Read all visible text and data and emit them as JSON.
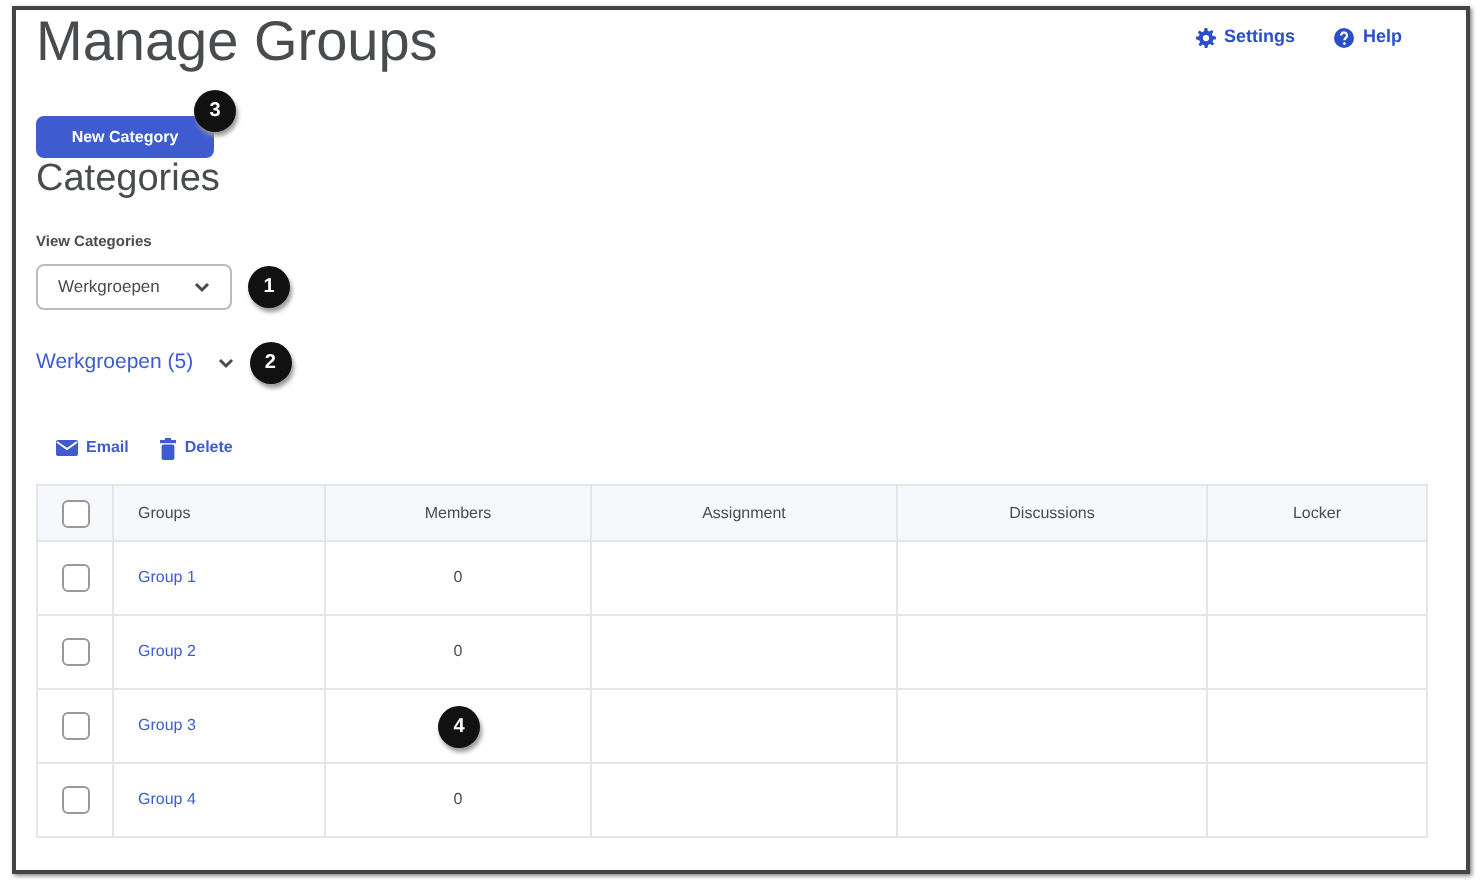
{
  "header": {
    "title": "Manage Groups",
    "links": [
      {
        "label": "Settings",
        "kind": "settings"
      },
      {
        "label": "Help",
        "kind": "help"
      }
    ]
  },
  "new_category_button": {
    "label": "New Category",
    "callout": "3"
  },
  "section_title": "Categories",
  "view_label": "View Categories",
  "view_select": {
    "value": "Werkgroepen",
    "callout": "1"
  },
  "category": {
    "label": "Werkgroepen (5)",
    "expanded": true,
    "callout": "2"
  },
  "actions": [
    {
      "label": "Email",
      "kind": "email"
    },
    {
      "label": "Delete",
      "kind": "delete"
    }
  ],
  "table": {
    "select_all_checked": false,
    "columns": [
      "Groups",
      "Members",
      "Assignment",
      "Discussions",
      "Locker"
    ],
    "rows": [
      {
        "name": "Group 1",
        "members": "0",
        "checked": false
      },
      {
        "name": "Group 2",
        "members": "0",
        "checked": false
      },
      {
        "name": "Group 3",
        "checked": false,
        "callout": "4"
      },
      {
        "name": "Group 4",
        "members": "0",
        "checked": false
      }
    ]
  }
}
